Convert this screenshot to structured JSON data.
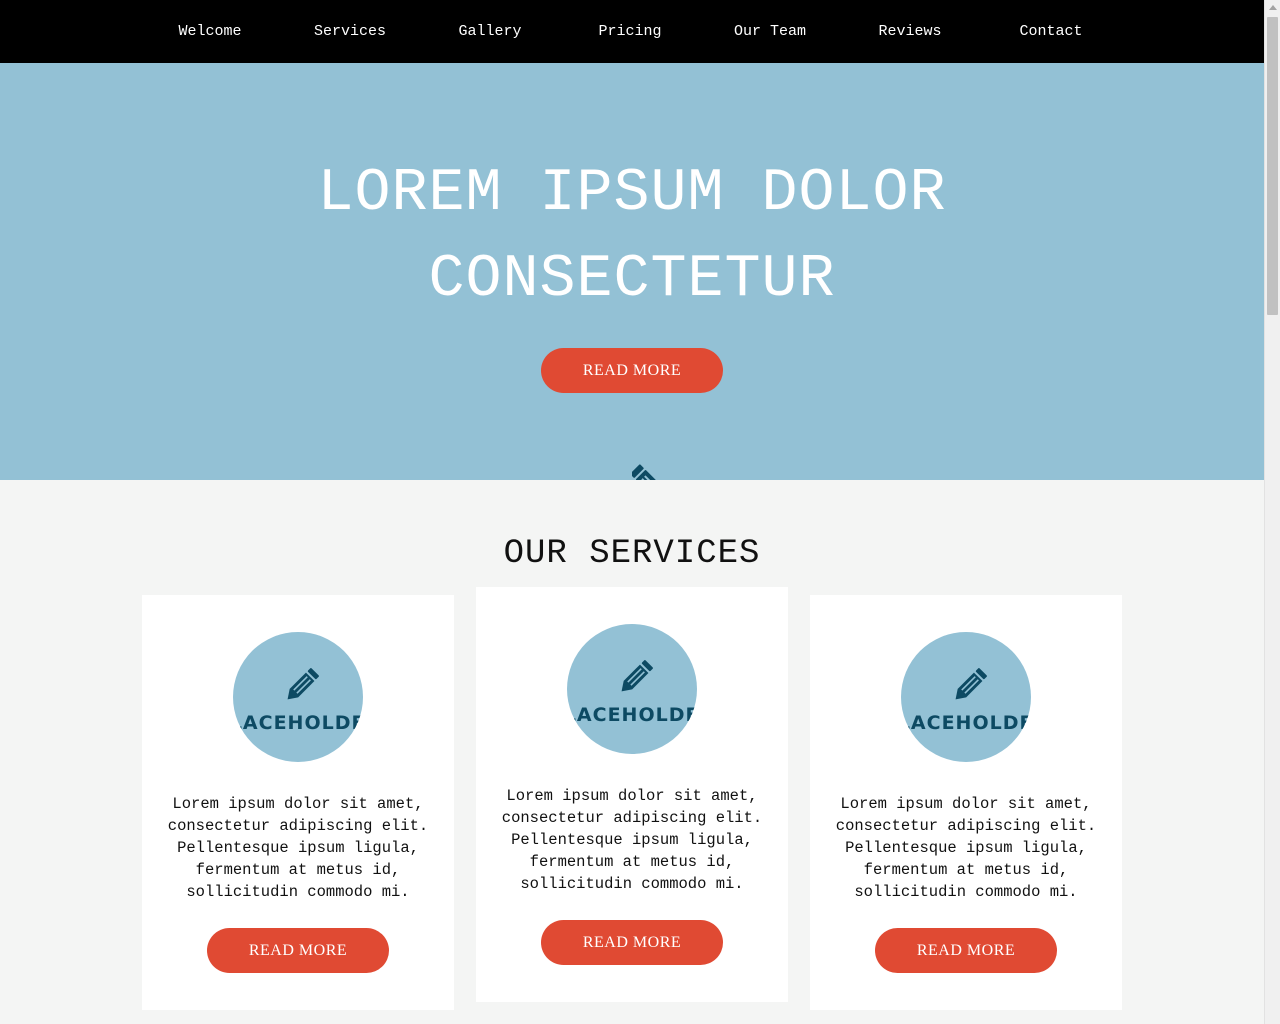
{
  "nav": {
    "items": [
      {
        "label": "Welcome"
      },
      {
        "label": "Services"
      },
      {
        "label": "Gallery"
      },
      {
        "label": "Pricing"
      },
      {
        "label": "Our Team"
      },
      {
        "label": "Reviews"
      },
      {
        "label": "Contact"
      }
    ]
  },
  "hero": {
    "title_line1": "LOREM IPSUM DOLOR",
    "title_line2": "CONSECTETUR",
    "button": "READ MORE",
    "background": "#93c1d5"
  },
  "services": {
    "title": "OUR SERVICES",
    "cards": [
      {
        "icon": "pencil-icon",
        "placeholder": "PLACEHOLDER",
        "text": "Lorem ipsum dolor sit amet, consectetur adipiscing elit. Pellentesque ipsum ligula, fermentum at metus id, sollicitudin commodo mi.",
        "button": "READ MORE"
      },
      {
        "icon": "pencil-icon",
        "placeholder": "PLACEHOLDER",
        "text": "Lorem ipsum dolor sit amet, consectetur adipiscing elit. Pellentesque ipsum ligula, fermentum at metus id, sollicitudin commodo mi.",
        "button": "READ MORE"
      },
      {
        "icon": "pencil-icon",
        "placeholder": "PLACEHOLDER",
        "text": "Lorem ipsum dolor sit amet, consectetur adipiscing elit. Pellentesque ipsum ligula, fermentum at metus id, sollicitudin commodo mi.",
        "button": "READ MORE"
      }
    ]
  },
  "colors": {
    "nav_bg": "#000000",
    "accent_button": "#e04a33",
    "icon_dark": "#0d4a63",
    "page_bg": "#f4f5f4"
  }
}
